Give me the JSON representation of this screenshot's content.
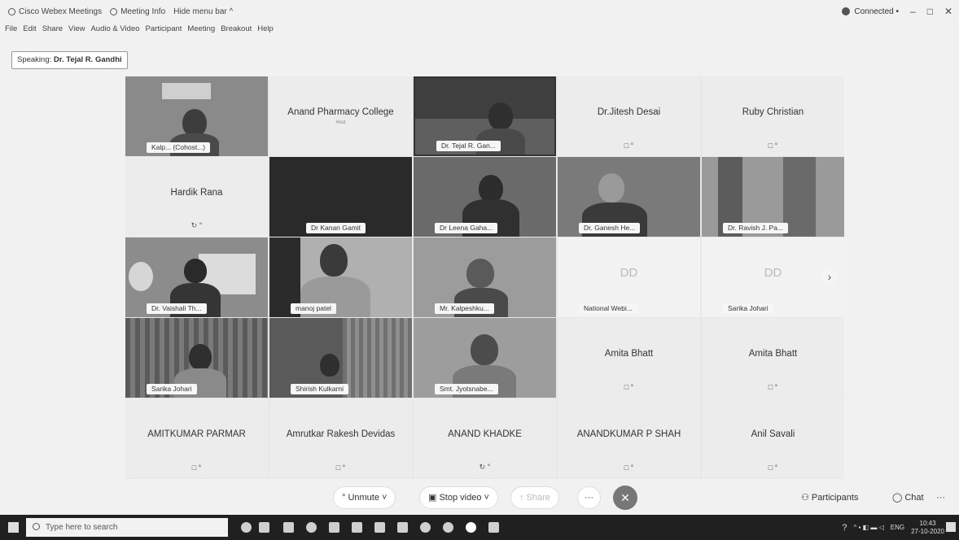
{
  "titlebar": {
    "app": "Cisco Webex Meetings",
    "meeting_info": "Meeting Info",
    "hide_menu": "Hide menu bar ^",
    "connected": "Connected •",
    "minimize": "–",
    "maximize": "□",
    "close": "✕"
  },
  "menubar": [
    "File",
    "Edit",
    "Share",
    "View",
    "Audio & Video",
    "Participant",
    "Meeting",
    "Breakout",
    "Help"
  ],
  "speaking": {
    "prefix": "Speaking:",
    "name": "Dr. Tejal R. Gandhi"
  },
  "tiles": [
    {
      "label": "Kalp... (Cohost...)"
    },
    {
      "name": "Anand Pharmacy College",
      "sub": "Host"
    },
    {
      "label": "Dr. Tejal R. Gan..."
    },
    {
      "name": "Dr.Jitesh Desai",
      "mini": "□ °"
    },
    {
      "name": "Ruby Christian",
      "mini": "□ °"
    },
    {
      "name": "Hardik Rana",
      "mini": "↻ °"
    },
    {
      "label": "Dr Kanan Gamit"
    },
    {
      "label": "Dr Leena Gaha..."
    },
    {
      "label": "Dr. Ganesh He..."
    },
    {
      "label": "Dr. Ravish J. Pa..."
    },
    {
      "label": "Dr. Vaishali Th..."
    },
    {
      "label": "manoj patel"
    },
    {
      "label": "Mr. Kalpeshku..."
    },
    {
      "avatar": "DD",
      "label": "National Webi..."
    },
    {
      "avatar": "DD",
      "label": "Sarika Johari"
    },
    {
      "label": "Sarika Johari"
    },
    {
      "label": "Shirish Kulkarni"
    },
    {
      "label": "Smt. Jyotsnabe..."
    },
    {
      "name": "Amita Bhatt",
      "mini": "□ °"
    },
    {
      "name": "Amita Bhatt",
      "mini": "□ °"
    },
    {
      "name": "AMITKUMAR PARMAR",
      "mini": "□ °"
    },
    {
      "name": "Amrutkar Rakesh Devidas",
      "mini": "□ °"
    },
    {
      "name": "ANAND KHADKE",
      "mini": "↻ °"
    },
    {
      "name": "ANANDKUMAR P SHAH",
      "mini": "□ °"
    },
    {
      "name": "Anil Savali",
      "mini": "□ °"
    }
  ],
  "controls": {
    "unmute": "° Unmute ˅",
    "stop_video": "▣ Stop video ˅",
    "share": "↑ Share",
    "more": "···",
    "end": "✕",
    "participants": "⚇ Participants",
    "chat": "◯ Chat",
    "more_right": "···"
  },
  "taskbar": {
    "search_placeholder": "Type here to search",
    "lang": "ENG",
    "time": "10:43",
    "date": "27-10-2020"
  }
}
